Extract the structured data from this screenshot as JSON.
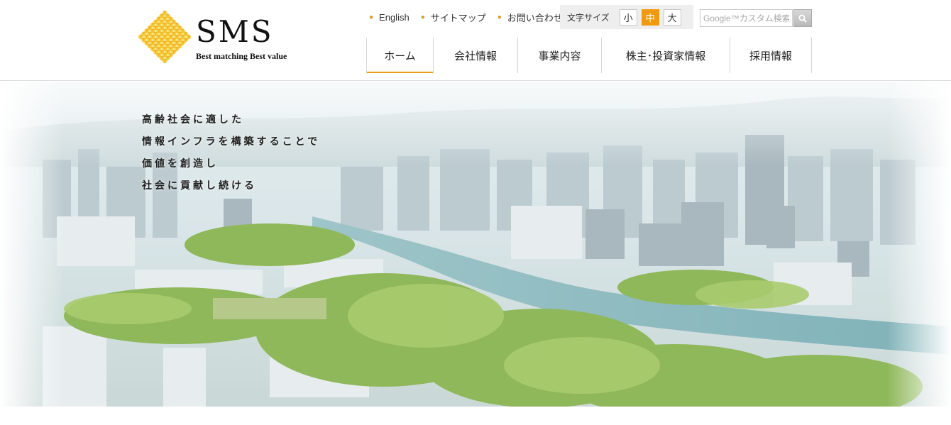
{
  "brand": {
    "name": "SMS",
    "tagline": "Best matching  Best value",
    "accent_color": "#f29a0f"
  },
  "util_nav": [
    {
      "label": "English"
    },
    {
      "label": "サイトマップ"
    },
    {
      "label": "お問い合わせ"
    }
  ],
  "font_size": {
    "label": "文字サイズ",
    "options": [
      "小",
      "中",
      "大"
    ],
    "selected": "中"
  },
  "search": {
    "placeholder": "Google™カスタム検索",
    "button_icon": "search-icon"
  },
  "global_nav": [
    {
      "label": "ホーム",
      "active": true
    },
    {
      "label": "会社情報",
      "active": false
    },
    {
      "label": "事業内容",
      "active": false
    },
    {
      "label": "株主･投資家情報",
      "active": false
    },
    {
      "label": "採用情報",
      "active": false
    }
  ],
  "hero": {
    "lines": [
      "高齢社会に適した",
      "情報インフラを構築することで",
      "価値を創造し",
      "社会に貢献し続ける"
    ]
  }
}
